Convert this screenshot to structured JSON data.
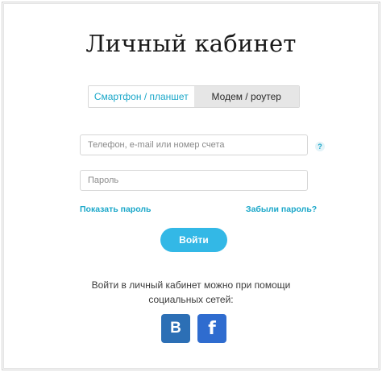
{
  "page": {
    "title": "Личный кабинет"
  },
  "tabs": [
    {
      "label": "Смартфон / планшет",
      "active": true
    },
    {
      "label": "Модем / роутер",
      "active": false
    }
  ],
  "form": {
    "login_placeholder": "Телефон, e-mail или номер счета",
    "password_placeholder": "Пароль",
    "help_symbol": "?",
    "show_password": "Показать пароль",
    "forgot_password": "Забыли пароль?",
    "submit_label": "Войти"
  },
  "social": {
    "text_line1": "Войти в личный кабинет можно при помощи",
    "text_line2": "социальных сетей:",
    "buttons": [
      {
        "label": "В",
        "icon": "vk-icon",
        "color": "#2c6fb5"
      },
      {
        "label": "f",
        "icon": "facebook-icon",
        "color": "#2f6ccf"
      }
    ]
  },
  "colors": {
    "accent": "#1aa7c9",
    "button": "#33b8e6"
  }
}
